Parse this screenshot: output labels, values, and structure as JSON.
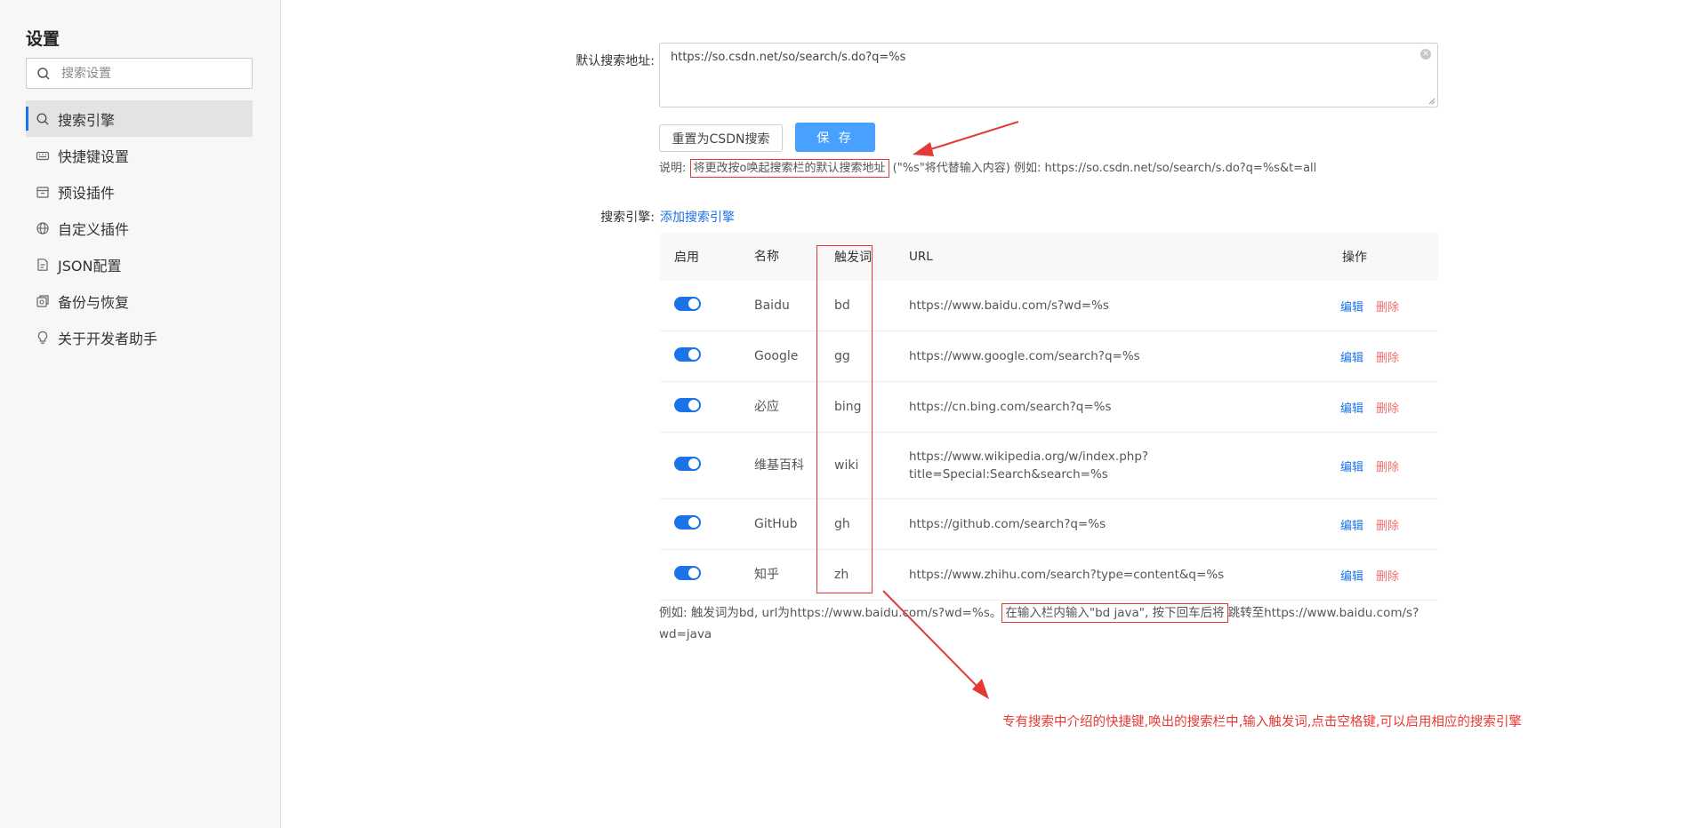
{
  "sidebar": {
    "title": "设置",
    "search_placeholder": "搜索设置",
    "items": [
      {
        "label": "搜索引擎",
        "icon": "search-icon",
        "active": true
      },
      {
        "label": "快捷键设置",
        "icon": "keyboard-icon"
      },
      {
        "label": "预设插件",
        "icon": "package-icon"
      },
      {
        "label": "自定义插件",
        "icon": "globe-icon"
      },
      {
        "label": "JSON配置",
        "icon": "json-file-icon"
      },
      {
        "label": "备份与恢复",
        "icon": "backup-icon"
      },
      {
        "label": "关于开发者助手",
        "icon": "lightbulb-icon"
      }
    ]
  },
  "main": {
    "default_url_label": "默认搜索地址:",
    "default_url_value": "https://so.csdn.net/so/search/s.do?q=%s",
    "reset_button": "重置为CSDN搜索",
    "save_button": "保 存",
    "note_prefix": "说明:",
    "note_highlight": "将更改按o唤起搜索栏的默认搜索地址",
    "note_suffix": "(\"%s\"将代替输入内容) 例如: https://so.csdn.net/so/search/s.do?q=%s&t=all",
    "engines_label": "搜索引擎:",
    "add_engine_link": "添加搜索引擎",
    "table_headers": {
      "enabled": "启用",
      "name": "名称",
      "trigger": "触发词",
      "url": "URL",
      "actions": "操作"
    },
    "edit_label": "编辑",
    "delete_label": "删除",
    "engines": [
      {
        "enabled": true,
        "name": "Baidu",
        "trigger": "bd",
        "url": "https://www.baidu.com/s?wd=%s"
      },
      {
        "enabled": true,
        "name": "Google",
        "trigger": "gg",
        "url": "https://www.google.com/search?q=%s"
      },
      {
        "enabled": true,
        "name": "必应",
        "trigger": "bing",
        "url": "https://cn.bing.com/search?q=%s"
      },
      {
        "enabled": true,
        "name": "维基百科",
        "trigger": "wiki",
        "url": "https://www.wikipedia.org/w/index.php?title=Special:Search&search=%s"
      },
      {
        "enabled": true,
        "name": "GitHub",
        "trigger": "gh",
        "url": "https://github.com/search?q=%s"
      },
      {
        "enabled": true,
        "name": "知乎",
        "trigger": "zh",
        "url": "https://www.zhihu.com/search?type=content&q=%s"
      }
    ],
    "example_prefix": "例如: 触发词为bd, url为https://www.baidu.com/s?wd=%s。",
    "example_highlight": "在输入栏内输入\"bd java\", 按下回车后将",
    "example_suffix": "跳转至https://www.baidu.com/s?wd=java",
    "annotation": "专有搜索中介绍的快捷键,唤出的搜索栏中,输入触发词,点击空格键,可以启用相应的搜索引擎"
  },
  "colors": {
    "accent": "#1a73e8",
    "save_button": "#49a1ff",
    "delete": "#f56c6c",
    "annotation_red": "#e53935"
  }
}
